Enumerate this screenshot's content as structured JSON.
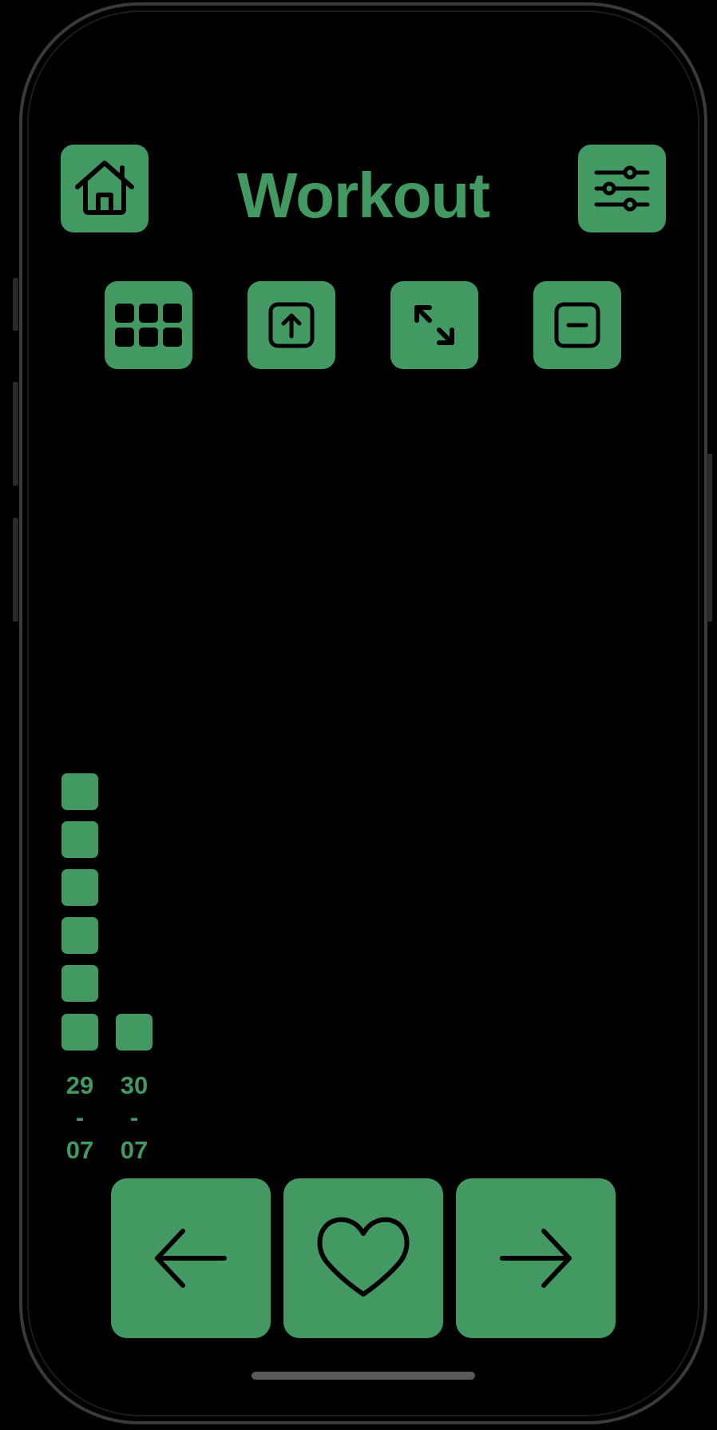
{
  "header": {
    "title": "Workout",
    "home_icon": "house-icon",
    "settings_icon": "sliders-icon"
  },
  "toolbar": {
    "items": [
      {
        "icon": "grid-icon"
      },
      {
        "icon": "upload-box-icon"
      },
      {
        "icon": "expand-arrows-icon"
      },
      {
        "icon": "minus-box-icon"
      }
    ]
  },
  "history_chart": {
    "columns": [
      {
        "day": "29",
        "separator": "-",
        "month": "07",
        "count": 6
      },
      {
        "day": "30",
        "separator": "-",
        "month": "07",
        "count": 1
      }
    ]
  },
  "navigation": {
    "previous_icon": "arrow-left-icon",
    "favorite_icon": "heart-icon",
    "next_icon": "arrow-right-icon"
  },
  "colors": {
    "accent": "#429962",
    "background": "#000000"
  }
}
